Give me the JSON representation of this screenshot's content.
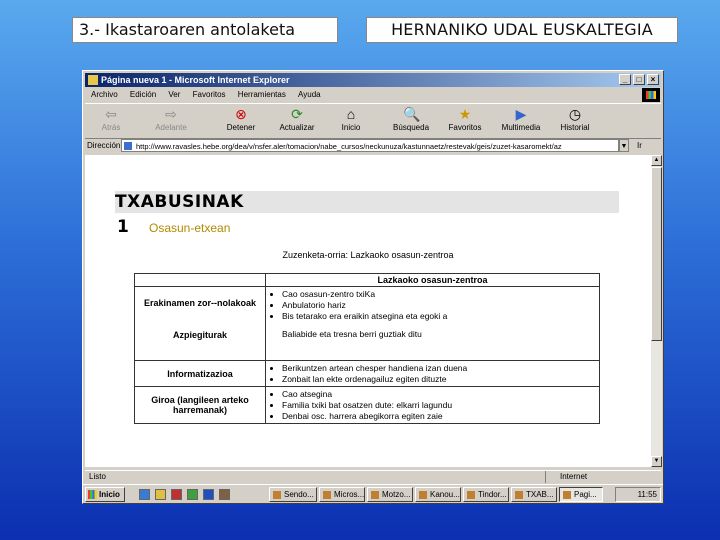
{
  "slide": {
    "header_left": "3.- Ikastaroaren antolaketa",
    "header_right": "HERNANIKO UDAL EUSKALTEGIA"
  },
  "browser": {
    "title": "Página nueva 1 - Microsoft Internet Explorer",
    "menu": [
      "Archivo",
      "Edición",
      "Ver",
      "Favoritos",
      "Herramientas",
      "Ayuda"
    ],
    "toolbar": {
      "back": "Atrás",
      "forward": "Adelante",
      "stop": "Detener",
      "refresh": "Actualizar",
      "home": "Inicio",
      "search": "Búsqueda",
      "favorites": "Favoritos",
      "multimedia": "Multimedia",
      "history": "Historial"
    },
    "address_label": "Dirección",
    "address_value": "http://www.ravasles.hebe.org/dea/v/nsfer.aler/tomacion/nabe_cursos/neckunuza/kastunnaetz/restevak/geis/zuzet-kasaromekt/az",
    "go_label": "Ir",
    "status_left": "Listo",
    "status_right": "Internet"
  },
  "page": {
    "title": "TXABUSINAK",
    "number": "1",
    "subtitle": "Osasun-etxean",
    "caption": "Zuzenketa-orria: Lazkaoko osasun-zentroa",
    "table": {
      "header": "Lazkaoko osasun-zentroa",
      "rows": [
        {
          "label": "Erakinamen zor--nolakoak",
          "bullets": [
            "Cao osasun-zentro txiKa",
            "Anbulatorio hariz",
            "Bis tetarako era eraikin atsegina eta egoki a"
          ],
          "extra_text": "Baliabide eta tresna berri guztiak ditu",
          "extra_label": "Azpiegiturak"
        },
        {
          "label": "Informatizazioa",
          "bullets": [
            "Berikuntzen artean chesper handiena izan duena",
            "Zonbait lan ekte ordenagailuz egiten dituzte"
          ]
        },
        {
          "label": "Giroa (langileen arteko harremanak)",
          "bullets": [
            "Cao atsegina",
            "Familia txiki bat osatzen dute: elkarri lagundu",
            "Denbai osc. harrera abegikorra egiten zaie"
          ]
        }
      ]
    }
  },
  "taskbar": {
    "start": "Inicio",
    "tasks": [
      "Sendo...",
      "Micros...",
      "Motzo...",
      "Kanou...",
      "Tindor...",
      "TXAB...",
      "Pagi..."
    ],
    "clock": "11:55"
  }
}
